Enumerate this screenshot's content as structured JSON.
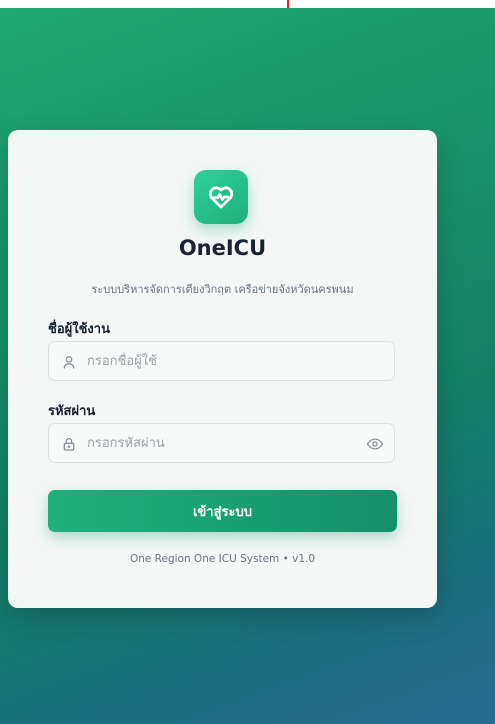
{
  "app": {
    "title": "OneICU",
    "subtitle": "ระบบบริหารจัดการเตียงวิกฤต เครือข่ายจังหวัดนครพนม",
    "logo_icon": "heart-pulse-icon",
    "accent_color": "#1fae7b"
  },
  "form": {
    "username": {
      "label": "ชื่อผู้ใช้งาน",
      "placeholder": "กรอกชื่อผู้ใช้",
      "value": "",
      "icon": "user-icon"
    },
    "password": {
      "label": "รหัสผ่าน",
      "placeholder": "กรอกรหัสผ่าน",
      "value": "",
      "icon": "lock-icon",
      "toggle_icon": "eye-icon"
    },
    "submit_label": "เข้าสู่ระบบ"
  },
  "footer": {
    "text": "One Region One ICU System • v1.0"
  }
}
